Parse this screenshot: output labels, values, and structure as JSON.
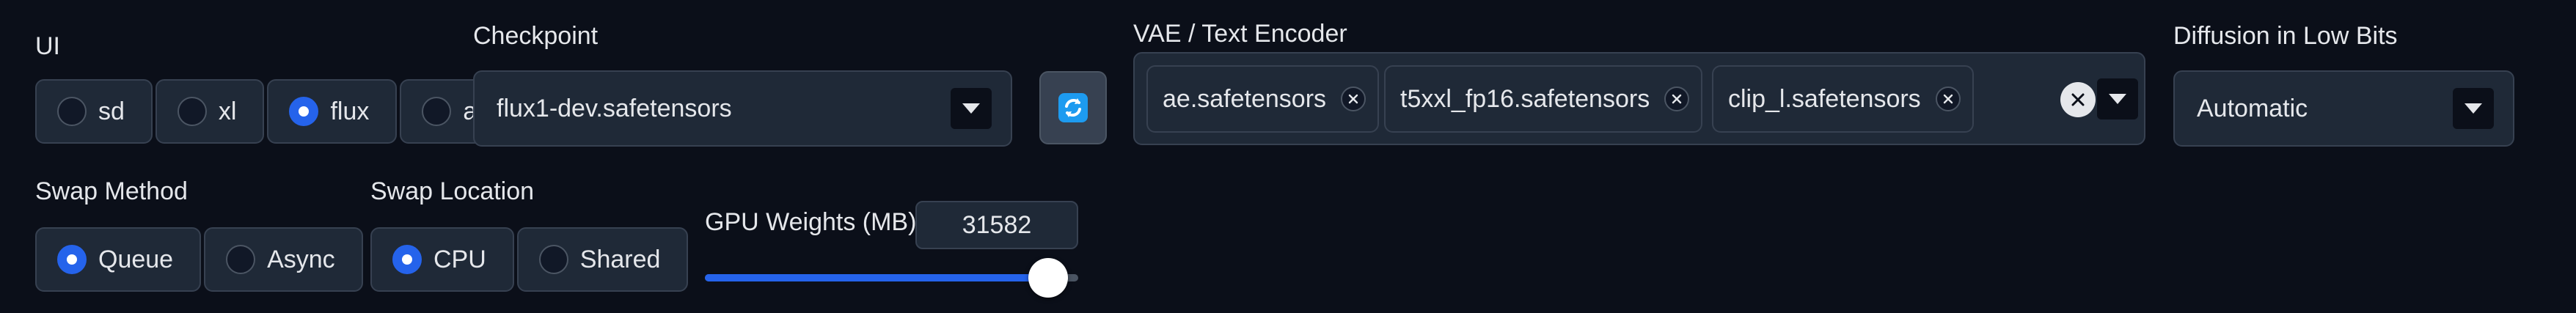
{
  "ui": {
    "label": "UI",
    "options": [
      {
        "label": "sd",
        "checked": false
      },
      {
        "label": "xl",
        "checked": false
      },
      {
        "label": "flux",
        "checked": true
      },
      {
        "label": "all",
        "checked": false
      }
    ]
  },
  "checkpoint": {
    "label": "Checkpoint",
    "value": "flux1-dev.safetensors",
    "caret_icon": "chevron-down-icon"
  },
  "refresh": {
    "icon": "refresh-icon"
  },
  "vae": {
    "label": "VAE / Text Encoder",
    "tags": [
      "ae.safetensors",
      "t5xxl_fp16.safetensors",
      "clip_l.safetensors"
    ]
  },
  "diffusion": {
    "label": "Diffusion in Low Bits",
    "value": "Automatic"
  },
  "swap_method": {
    "label": "Swap Method",
    "options": [
      {
        "label": "Queue",
        "checked": true
      },
      {
        "label": "Async",
        "checked": false
      }
    ]
  },
  "swap_location": {
    "label": "Swap Location",
    "options": [
      {
        "label": "CPU",
        "checked": true
      },
      {
        "label": "Shared",
        "checked": false
      }
    ]
  },
  "gpu_weights": {
    "label": "GPU Weights (MB)",
    "value": "31582",
    "slider_fraction": 0.92
  },
  "colors": {
    "background": "#0b0f19",
    "accent": "#2563eb",
    "panel": "#1f2937"
  }
}
